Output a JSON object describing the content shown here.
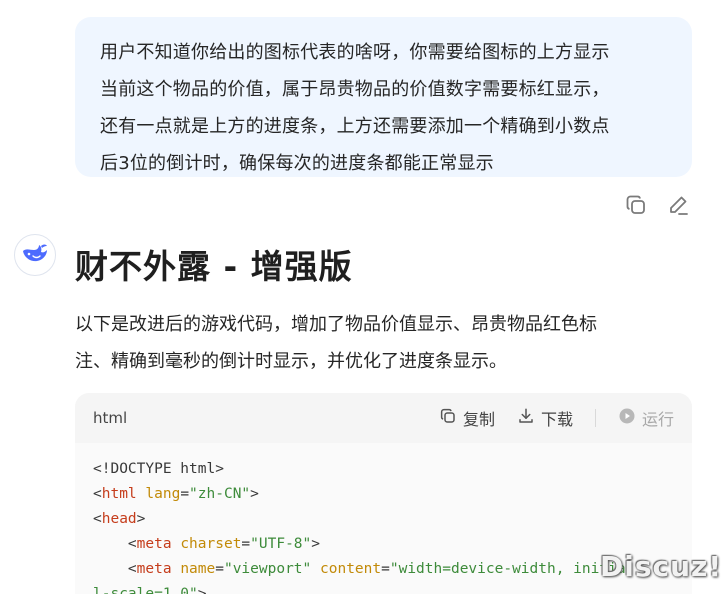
{
  "user_message": {
    "lines": [
      "用户不知道你给出的图标代表的啥呀，你需要给图标的上方显示",
      "当前这个物品的价值，属于昂贵物品的价值数字需要标红显示，",
      "还有一点就是上方的进度条，上方还需要添加一个精确到小数点",
      "后3位的倒计时，确保每次的进度条都能正常显示"
    ]
  },
  "message_actions": {
    "copy_icon": "copy-icon",
    "edit_icon": "edit-icon"
  },
  "assistant": {
    "avatar_icon": "whale-logo-icon",
    "title": "财不外露 - 增强版",
    "desc_lines": [
      "以下是改进后的游戏代码，增加了物品价值显示、昂贵物品红色标",
      "注、精确到毫秒的倒计时显示，并优化了进度条显示。"
    ]
  },
  "code_block": {
    "language": "html",
    "copy_label": "复制",
    "download_label": "下载",
    "run_label": "运行",
    "lines": [
      [
        {
          "t": "punc",
          "v": "<!DOCTYPE html>"
        }
      ],
      [
        {
          "t": "punc",
          "v": "<"
        },
        {
          "t": "tag",
          "v": "html"
        },
        {
          "t": "punc",
          "v": " "
        },
        {
          "t": "attr",
          "v": "lang"
        },
        {
          "t": "punc",
          "v": "="
        },
        {
          "t": "str",
          "v": "\"zh-CN\""
        },
        {
          "t": "punc",
          "v": ">"
        }
      ],
      [
        {
          "t": "punc",
          "v": "<"
        },
        {
          "t": "tag",
          "v": "head"
        },
        {
          "t": "punc",
          "v": ">"
        }
      ],
      [
        {
          "t": "punc",
          "v": "    <"
        },
        {
          "t": "tag",
          "v": "meta"
        },
        {
          "t": "punc",
          "v": " "
        },
        {
          "t": "attr",
          "v": "charset"
        },
        {
          "t": "punc",
          "v": "="
        },
        {
          "t": "str",
          "v": "\"UTF-8\""
        },
        {
          "t": "punc",
          "v": ">"
        }
      ],
      [
        {
          "t": "punc",
          "v": "    <"
        },
        {
          "t": "tag",
          "v": "meta"
        },
        {
          "t": "punc",
          "v": " "
        },
        {
          "t": "attr",
          "v": "name"
        },
        {
          "t": "punc",
          "v": "="
        },
        {
          "t": "str",
          "v": "\"viewport\""
        },
        {
          "t": "punc",
          "v": " "
        },
        {
          "t": "attr",
          "v": "content"
        },
        {
          "t": "punc",
          "v": "="
        },
        {
          "t": "str",
          "v": "\"width=device-width, initia"
        }
      ],
      [
        {
          "t": "str",
          "v": "l-scale=1.0\""
        },
        {
          "t": "punc",
          "v": ">"
        }
      ]
    ]
  },
  "watermark": "Discuz!"
}
